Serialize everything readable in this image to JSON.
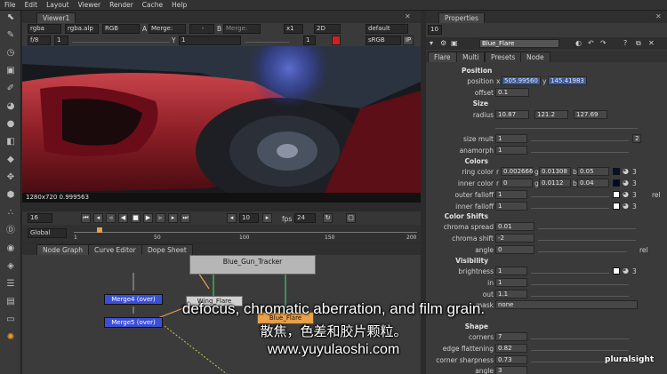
{
  "menu": [
    "File",
    "Edit",
    "Layout",
    "Viewer",
    "Render",
    "Cache",
    "Help"
  ],
  "viewer": {
    "tab": "Viewer1",
    "channels": "rgba",
    "channel_sel": "rgba.alp",
    "colorspace": "RGB",
    "a_label": "A",
    "a_input": "Merge:",
    "b_label": "B",
    "b_input": "Merge:",
    "zoom": "x1",
    "view_mode": "2D",
    "lut": "default",
    "fstop": "f/8",
    "gain": "1",
    "gamma_label": "Y",
    "gamma": "1",
    "frame_val": "1",
    "display": "sRGB",
    "ip": "IP",
    "status": "1280x720  0.999563",
    "cur_frame": "16",
    "step": "10",
    "fps_label": "fps",
    "fps": "24",
    "range": "Global",
    "ruler_ticks": [
      "1",
      "50",
      "100",
      "150",
      "200"
    ]
  },
  "nodegraph": {
    "tabs": [
      "Node Graph",
      "Curve Editor",
      "Dope Sheet"
    ],
    "nodes": {
      "tracker": "Blue_Gun_Tracker",
      "wing": "Wing_Flare",
      "merge4": "Merge4 (over)",
      "merge5": "Merge5 (over)",
      "blueflare": "Blue_Flare"
    }
  },
  "properties": {
    "tab": "Properties",
    "count": "10",
    "node_name": "Blue_Flare",
    "tabs": [
      "Flare",
      "Multi",
      "Presets",
      "Node"
    ],
    "sections": {
      "position": "Position",
      "size": "Size",
      "colors": "Colors",
      "color_shifts": "Color Shifts",
      "visibility": "Visibility",
      "shape": "Shape"
    },
    "position": {
      "label": "position",
      "x_label": "x",
      "x": "505.99560",
      "y_label": "y",
      "y": "145.41983"
    },
    "offset": {
      "label": "offset",
      "value": "0.1"
    },
    "radius": {
      "label": "radius",
      "v1": "10.87",
      "v2": "121.2",
      "v3": "127.69"
    },
    "size_mult": {
      "label": "size mult",
      "value": "1",
      "extra": "2"
    },
    "anamorph": {
      "label": "anamorph",
      "value": "1"
    },
    "ring_color": {
      "label": "ring color",
      "r_label": "r",
      "r": "0.002666",
      "g_label": "g",
      "g": "0.01308",
      "b_label": "b",
      "b": "0.05",
      "count": "3"
    },
    "inner_color": {
      "label": "inner color",
      "r_label": "r",
      "r": "0",
      "g_label": "g",
      "g": "0.0112",
      "b_label": "b",
      "b": "0.04",
      "count": "3"
    },
    "outer_falloff": {
      "label": "outer falloff",
      "value": "1",
      "count": "3",
      "rel": "rel"
    },
    "inner_falloff": {
      "label": "inner falloff",
      "value": "1",
      "count": "3"
    },
    "chroma_spread": {
      "label": "chroma spread",
      "value": "0.01"
    },
    "chroma_shift": {
      "label": "chroma shift",
      "value": "-2"
    },
    "angle1": {
      "label": "angle",
      "value": "0",
      "rel": "rel"
    },
    "brightness": {
      "label": "brightness",
      "value": "1",
      "count": "3"
    },
    "in": {
      "label": "in",
      "value": "1"
    },
    "out": {
      "label": "out",
      "value": "1.1"
    },
    "mask": {
      "label": "mask",
      "value": "none"
    },
    "corners": {
      "label": "corners",
      "value": "7"
    },
    "edge_flattening": {
      "label": "edge flattening",
      "value": "0.82"
    },
    "corner_sharpness": {
      "label": "corner sharpness",
      "value": "0.73"
    },
    "angle2": {
      "label": "angle",
      "value": "3"
    }
  },
  "subtitles": {
    "en": "defocus, chromatic aberration, and film grain.",
    "zh": "散焦，色差和胶片颗粒。",
    "url": "www.yuyulaoshi.com"
  },
  "watermark": "pluralsight",
  "colors": {
    "accent": "#3d6bbf",
    "node_blue": "#3b4fd6",
    "node_orange": "#e8a04a",
    "bg": "#2b2b2b"
  }
}
